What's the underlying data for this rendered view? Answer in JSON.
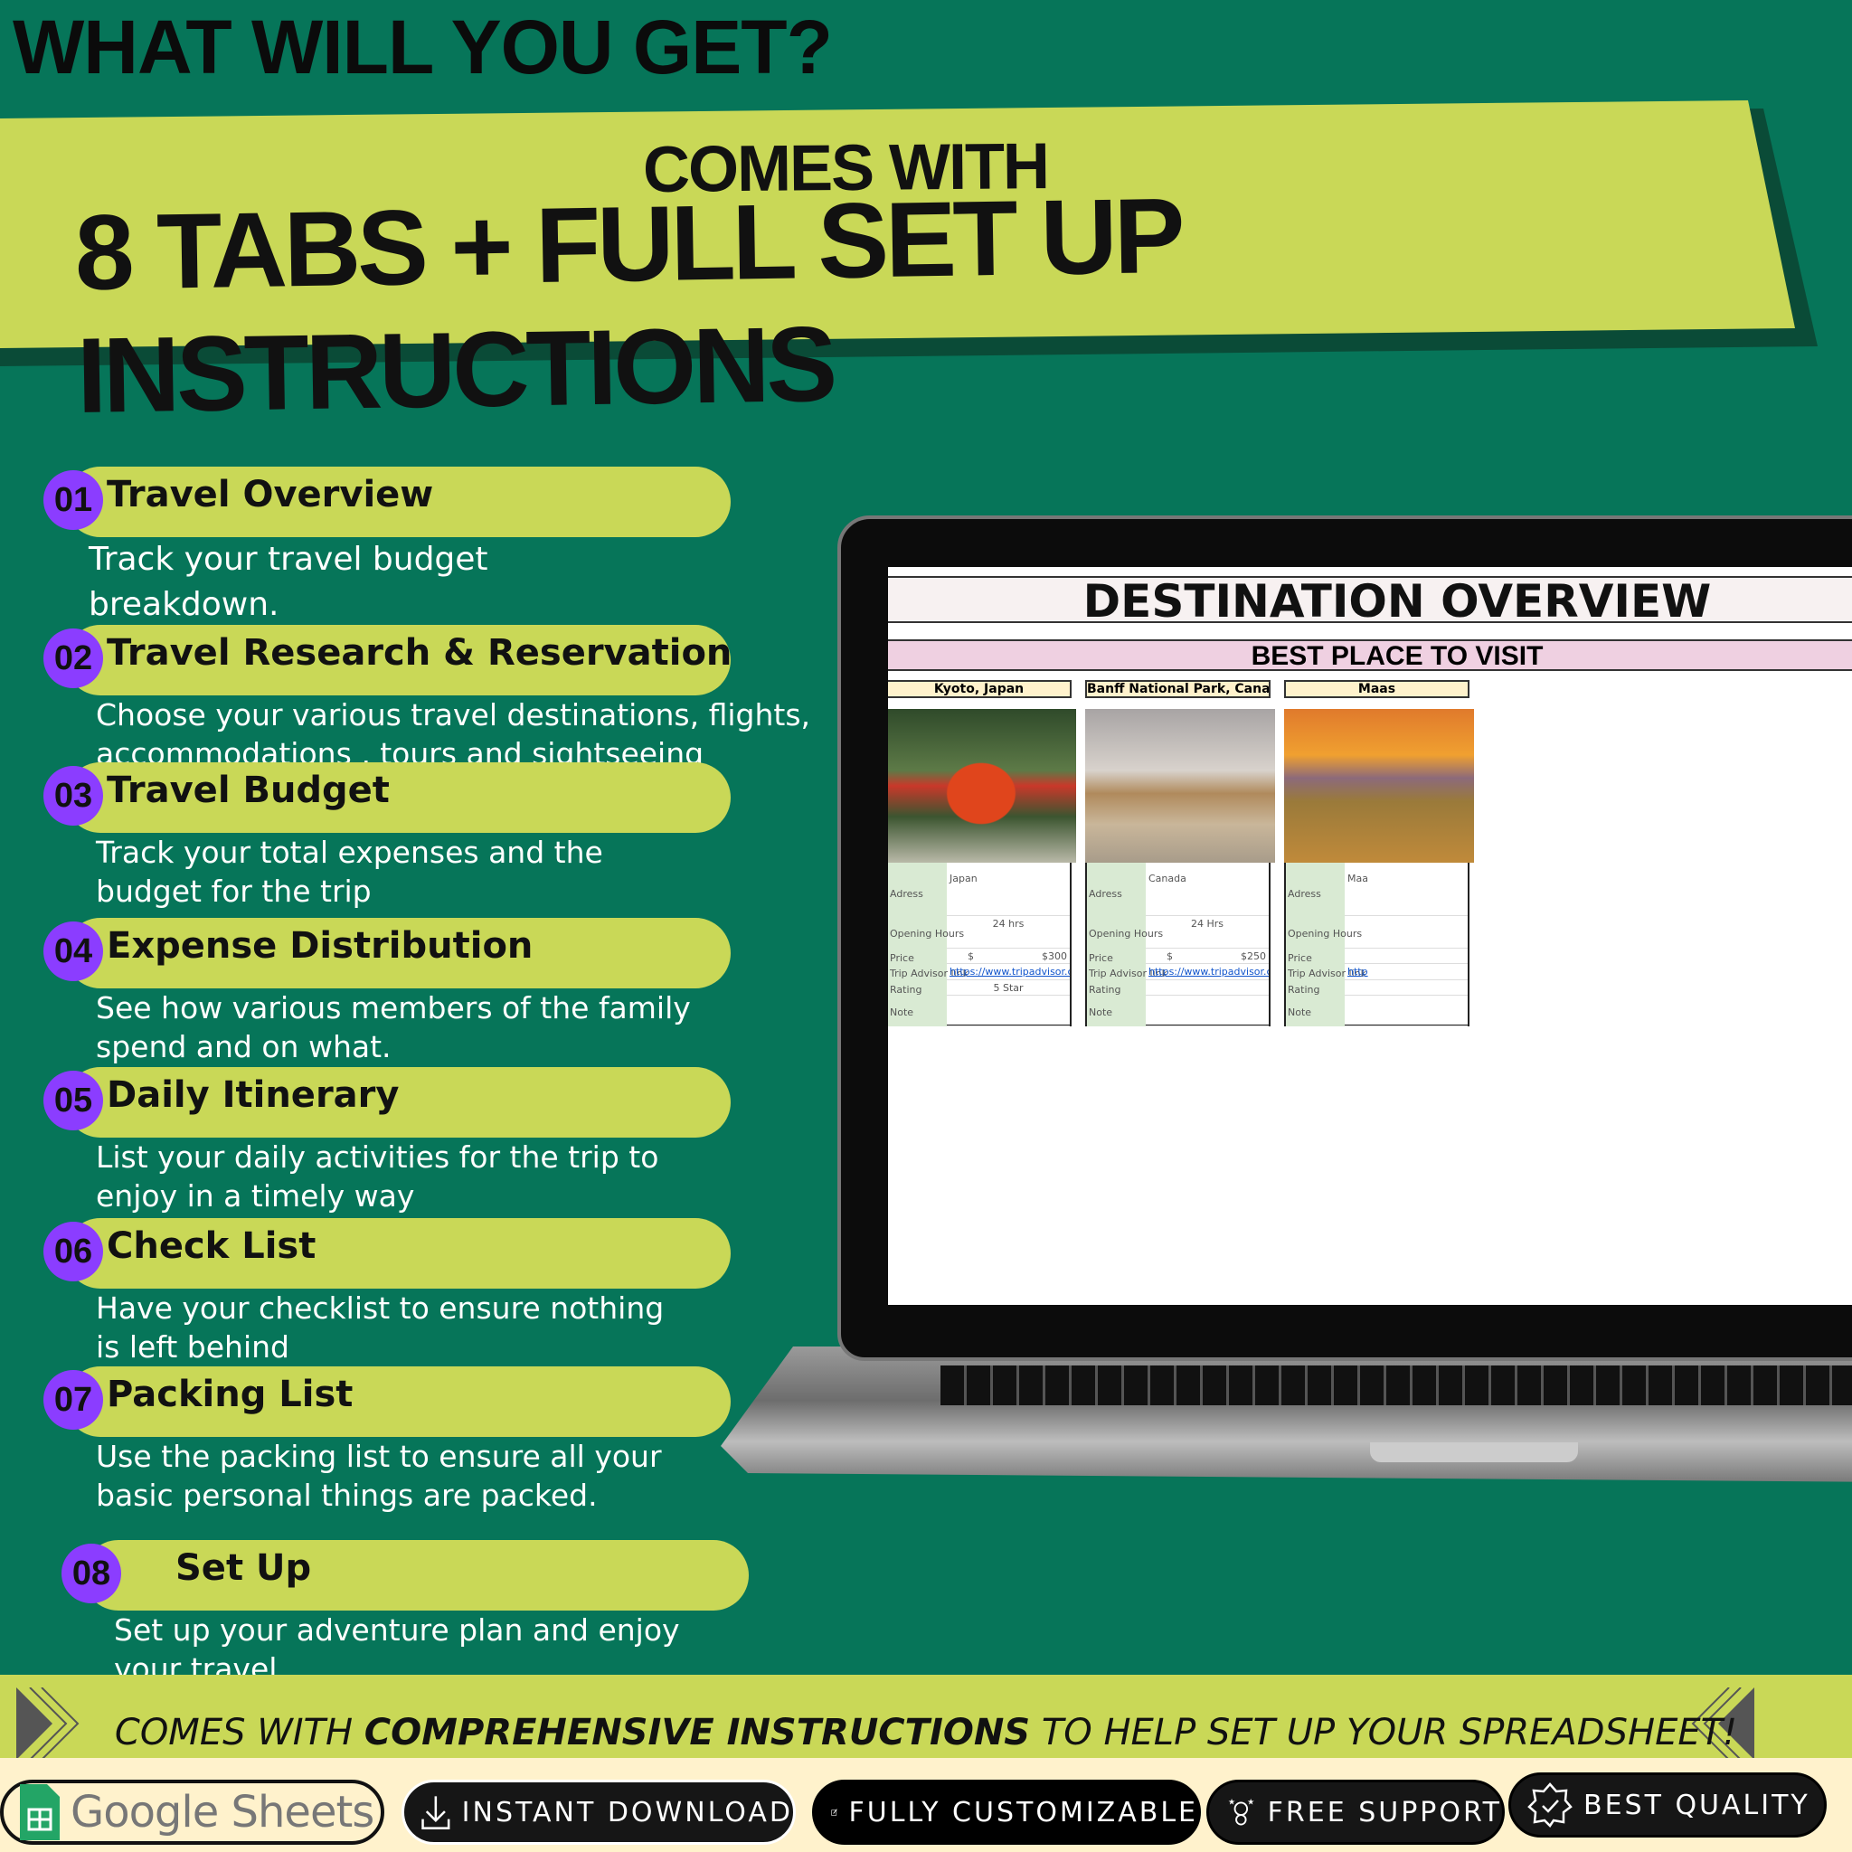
{
  "headline": "WHAT WILL YOU GET?",
  "banner": {
    "line1": "COMES WITH",
    "line2": "8 TABS + FULL SET UP INSTRUCTIONS"
  },
  "colors": {
    "background": "#067559",
    "lime": "#c9d857",
    "purple": "#8b3dff",
    "cream": "#fff2cc"
  },
  "items": [
    {
      "num": "01",
      "title": "Travel Overview",
      "desc": "Track your travel budget breakdown."
    },
    {
      "num": "02",
      "title": "Travel Research & Reservation",
      "desc": "Choose your various travel destinations, flights, accommodations , tours and sightseeing"
    },
    {
      "num": "03",
      "title": "Travel Budget",
      "desc": "Track your total expenses and the budget for the trip"
    },
    {
      "num": "04",
      "title": "Expense Distribution",
      "desc": "See how various members of the family spend and on what."
    },
    {
      "num": "05",
      "title": "Daily Itinerary",
      "desc": "List your daily activities for the trip to enjoy in a timely way"
    },
    {
      "num": "06",
      "title": "Check List",
      "desc": "Have your checklist to ensure nothing is left behind"
    },
    {
      "num": "07",
      "title": "Packing List",
      "desc": "Use the packing list to ensure all your basic personal things are packed."
    },
    {
      "num": "08",
      "title": "Set Up",
      "desc": "Set up your adventure plan and enjoy your travel."
    }
  ],
  "sheet": {
    "title": "DESTINATION OVERVIEW",
    "subtitle": "BEST PLACE TO VISIT",
    "labels": {
      "address": "Adress",
      "hours": "Opening Hours",
      "price": "Price",
      "link": "Trip Advisor link",
      "rating": "Rating",
      "note": "Note"
    },
    "cards": [
      {
        "name": "Kyoto, Japan",
        "address": "Japan",
        "hours": "24 hrs",
        "currency": "$",
        "price": "$300",
        "link": "https://www.tripadvisor.com/Search",
        "rating": "5 Star"
      },
      {
        "name": "Banff National Park, Canada",
        "address": "Canada",
        "hours": "24 Hrs",
        "currency": "$",
        "price": "$250",
        "link": "https://www.tripadvisor.com/Search",
        "rating": ""
      },
      {
        "name": "Maas",
        "address": "Maa",
        "hours": "",
        "currency": "",
        "price": "",
        "link": "http",
        "rating": ""
      }
    ]
  },
  "footer": {
    "text_pre": "COMES WITH ",
    "text_bold": "COMPREHENSIVE INSTRUCTIONS",
    "text_post": " TO HELP SET UP YOUR SPREADSHEET!",
    "badges": {
      "google": "Google Sheets",
      "download": "INSTANT DOWNLOAD",
      "custom": "FULLY CUSTOMIZABLE",
      "support": "FREE SUPPORT",
      "quality": "BEST QUALITY"
    }
  }
}
